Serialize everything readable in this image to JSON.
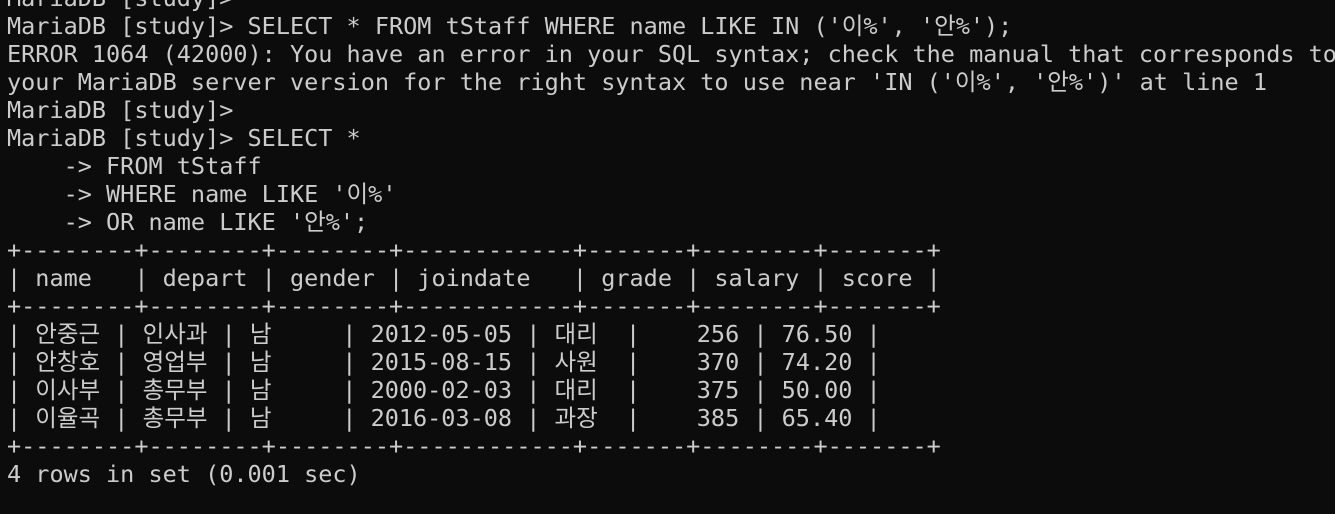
{
  "colors": {
    "background": "#0c0c0c",
    "foreground": "#cccccc"
  },
  "console": {
    "lines": [
      "MariaDB [study]>",
      "MariaDB [study]> SELECT * FROM tStaff WHERE name LIKE IN ('이%', '안%');",
      "ERROR 1064 (42000): You have an error in your SQL syntax; check the manual that corresponds to",
      "your MariaDB server version for the right syntax to use near 'IN ('이%', '안%')' at line 1",
      "MariaDB [study]>",
      "MariaDB [study]> SELECT *",
      "    -> FROM tStaff",
      "    -> WHERE name LIKE '이%'",
      "    -> OR name LIKE '안%';",
      "+--------+--------+--------+------------+-------+--------+-------+",
      "| name   | depart | gender | joindate   | grade | salary | score |",
      "+--------+--------+--------+------------+-------+--------+-------+",
      "| 안중근 | 인사과 | 남     | 2012-05-05 | 대리  |    256 | 76.50 |",
      "| 안창호 | 영업부 | 남     | 2015-08-15 | 사원  |    370 | 74.20 |",
      "| 이사부 | 총무부 | 남     | 2000-02-03 | 대리  |    375 | 50.00 |",
      "| 이율곡 | 총무부 | 남     | 2016-03-08 | 과장  |    385 | 65.40 |",
      "+--------+--------+--------+------------+-------+--------+-------+",
      "4 rows in set (0.001 sec)"
    ]
  }
}
